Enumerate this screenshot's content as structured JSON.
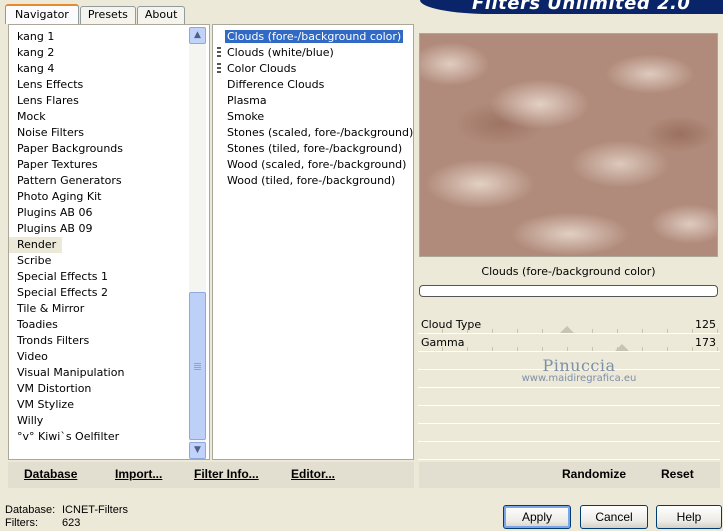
{
  "tabs": [
    {
      "label": "Navigator",
      "active": true
    },
    {
      "label": "Presets",
      "active": false
    },
    {
      "label": "About",
      "active": false
    }
  ],
  "banner": {
    "title": "Filters Unlimited 2.0"
  },
  "categories": {
    "items": [
      "kang 1",
      "kang 2",
      "kang 4",
      "Lens Effects",
      "Lens Flares",
      "Mock",
      "Noise Filters",
      "Paper Backgrounds",
      "Paper Textures",
      "Pattern Generators",
      "Photo Aging Kit",
      "Plugins AB 06",
      "Plugins AB 09",
      "Render",
      "Scribe",
      "Special Effects 1",
      "Special Effects 2",
      "Tile & Mirror",
      "Toadies",
      "Tronds Filters",
      "Video",
      "Visual Manipulation",
      "VM Distortion",
      "VM Stylize",
      "Willy",
      "°v° Kiwi`s Oelfilter"
    ],
    "selected": "Render"
  },
  "filters": {
    "items": [
      {
        "label": "Clouds (fore-/background color)",
        "selected": true,
        "marker": false
      },
      {
        "label": "Clouds (white/blue)",
        "selected": false,
        "marker": true
      },
      {
        "label": "Color Clouds",
        "selected": false,
        "marker": true
      },
      {
        "label": "Difference Clouds",
        "selected": false,
        "marker": false
      },
      {
        "label": "Plasma",
        "selected": false,
        "marker": false
      },
      {
        "label": "Smoke",
        "selected": false,
        "marker": false
      },
      {
        "label": "Stones (scaled, fore-/background)",
        "selected": false,
        "marker": false
      },
      {
        "label": "Stones (tiled, fore-/background)",
        "selected": false,
        "marker": false
      },
      {
        "label": "Wood (scaled, fore-/background)",
        "selected": false,
        "marker": false
      },
      {
        "label": "Wood (tiled, fore-/background)",
        "selected": false,
        "marker": false
      }
    ]
  },
  "preview": {
    "filter_name": "Clouds (fore-/background color)",
    "progress": 0
  },
  "params": [
    {
      "label": "Cloud Type",
      "value": "125",
      "level": 0.49
    },
    {
      "label": "Gamma",
      "value": "173",
      "level": 0.68
    }
  ],
  "watermark": {
    "line1": "Pinuccia",
    "line2": "www.maidiregrafica.eu"
  },
  "toolbar": {
    "database": "Database",
    "import": "Import...",
    "filter_info": "Filter Info...",
    "editor": "Editor...",
    "randomize": "Randomize",
    "reset": "Reset"
  },
  "status": {
    "database_label": "Database:",
    "database_value": "ICNET-Filters",
    "filters_label": "Filters:",
    "filters_value": "623"
  },
  "dialog_buttons": {
    "apply": "Apply",
    "cancel": "Cancel",
    "help": "Help"
  },
  "icons": {
    "scroll_up": "chevron-up-icon",
    "scroll_down": "chevron-down-icon"
  }
}
